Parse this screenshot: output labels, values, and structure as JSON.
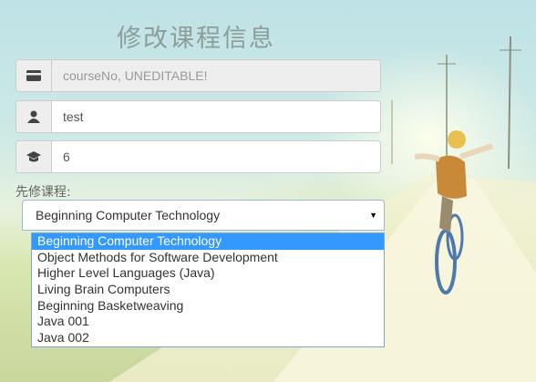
{
  "page": {
    "title": "修改课程信息"
  },
  "form": {
    "course_no": {
      "placeholder": "courseNo, UNEDITABLE!",
      "icon": "id-card-icon"
    },
    "course_name": {
      "value": "test",
      "icon": "user-icon"
    },
    "credit": {
      "value": "6",
      "icon": "graduation-cap-icon"
    },
    "prerequisite": {
      "label": "先修课程:",
      "selected": "Beginning Computer Technology",
      "options": [
        "Beginning Computer Technology",
        "Object Methods for Software Development",
        "Higher Level Languages (Java)",
        "Living Brain Computers",
        "Beginning Basketweaving",
        "Java 001",
        "Java 002"
      ]
    }
  }
}
